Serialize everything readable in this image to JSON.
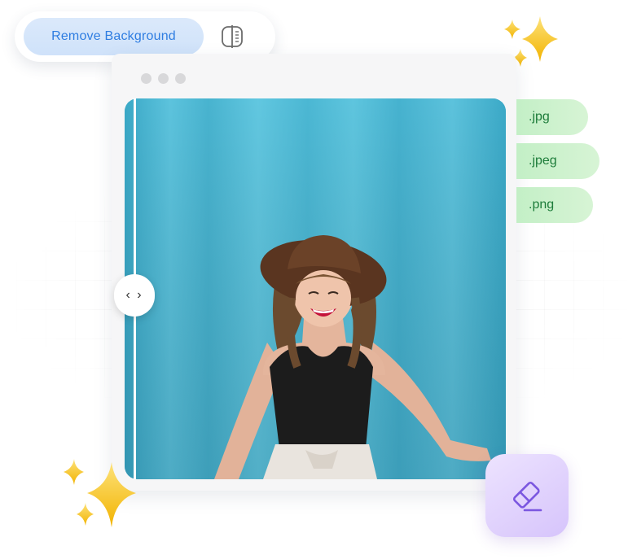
{
  "toolbar": {
    "remove_background_label": "Remove Background",
    "compare_icon": "split-compare-icon"
  },
  "window": {
    "dots": [
      "dot",
      "dot",
      "dot"
    ],
    "image": {
      "description_icon": "photo-preview",
      "slider_handle_label": "‹ ›"
    }
  },
  "formats": {
    "jpg": ".jpg",
    "jpeg": ".jpeg",
    "png": ".png"
  },
  "eraser": {
    "icon": "eraser-icon"
  },
  "colors": {
    "accent_blue": "#2f7de1",
    "button_bg": "#d4e5fa",
    "tag_green": "#c6f0c8",
    "tag_text": "#1d7c3a",
    "eraser_purple": "#7b57e0",
    "sparkle_gold": "#f7c21e",
    "photo_bg": "#4fb6d2"
  }
}
